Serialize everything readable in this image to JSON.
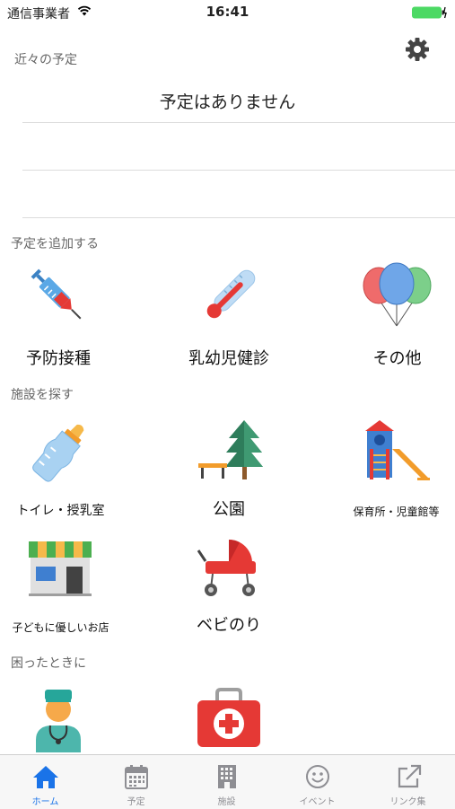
{
  "status_bar": {
    "carrier": "通信事業者",
    "time": "16:41"
  },
  "header": {
    "settings_icon": "gear-icon"
  },
  "upcoming": {
    "label": "近々の予定",
    "empty_text": "予定はありません"
  },
  "add_schedule": {
    "label": "予定を追加する",
    "items": [
      {
        "label": "予防接種",
        "icon": "syringe-icon"
      },
      {
        "label": "乳幼児健診",
        "icon": "thermometer-icon"
      },
      {
        "label": "その他",
        "icon": "balloons-icon"
      }
    ]
  },
  "find_facility": {
    "label": "施設を探す",
    "items": [
      {
        "label": "トイレ・授乳室",
        "icon": "baby-bottle-icon"
      },
      {
        "label": "公園",
        "icon": "park-icon"
      },
      {
        "label": "保育所・児童館等",
        "icon": "playground-slide-icon"
      },
      {
        "label": "子どもに優しいお店",
        "icon": "shop-icon"
      },
      {
        "label": "ベビのり",
        "icon": "stroller-icon"
      }
    ]
  },
  "in_trouble": {
    "label": "困ったときに",
    "items": [
      {
        "icon": "doctor-icon"
      },
      {
        "icon": "first-aid-kit-icon"
      }
    ]
  },
  "tab_bar": {
    "tabs": [
      {
        "label": "ホーム",
        "icon": "home-icon",
        "active": true
      },
      {
        "label": "予定",
        "icon": "calendar-icon",
        "active": false
      },
      {
        "label": "施設",
        "icon": "building-icon",
        "active": false
      },
      {
        "label": "イベント",
        "icon": "smiley-icon",
        "active": false
      },
      {
        "label": "リンク集",
        "icon": "external-link-icon",
        "active": false
      }
    ]
  },
  "colors": {
    "accent": "#1a73e8",
    "inactive": "#8e8e93",
    "battery": "#4cd964"
  }
}
